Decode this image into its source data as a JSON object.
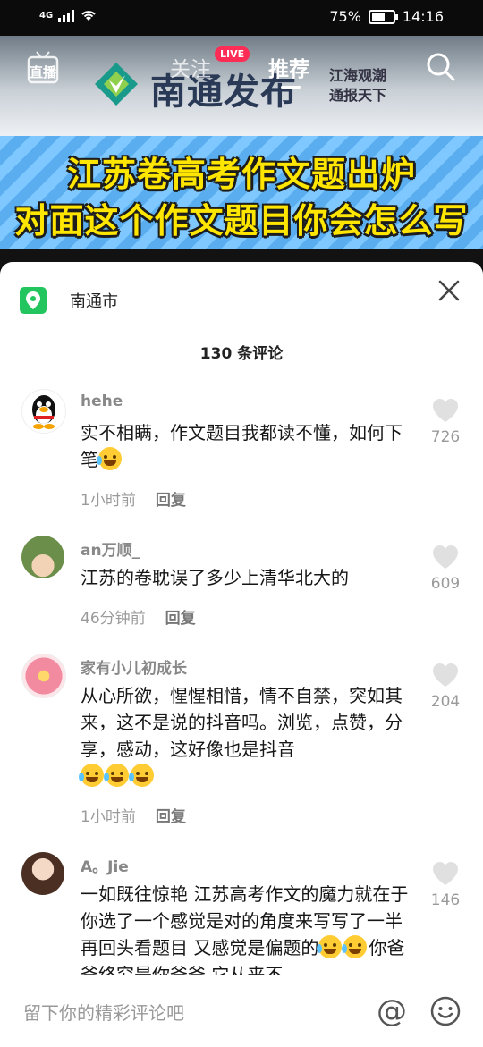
{
  "status_bar": {
    "network": "4G",
    "battery": "75%",
    "time": "14:16"
  },
  "video": {
    "brand_name": "南通发布",
    "brand_slogan_1": "江海观潮",
    "brand_slogan_2": "通报天下",
    "banner_line_1": "江苏卷高考作文题出炉",
    "banner_line_2": "对面这个作文题目你会怎么写"
  },
  "top_nav": {
    "live_label": "直播",
    "follow_tab": "关注",
    "live_badge": "LIVE",
    "recommend_tab": "推荐"
  },
  "comments_panel": {
    "location": "南通市",
    "count_label": "130 条评论",
    "reply_label": "回复",
    "comments": [
      {
        "user": "hehe",
        "text": "实不相瞒，作文题目我都读不懂，如何下笔",
        "time": "1小时前",
        "likes": "726"
      },
      {
        "user": "an万顺_",
        "text": "江苏的卷耽误了多少上清华北大的",
        "time": "46分钟前",
        "likes": "609"
      },
      {
        "user": "家有小儿初成长",
        "text": "从心所欲，惺惺相惜，情不自禁，突如其来，这不是说的抖音吗。浏览，点赞，分享，感动，这好像也是抖音",
        "time": "1小时前",
        "likes": "204"
      },
      {
        "user": "A。Jie",
        "text": "一如既往惊艳 江苏高考作文的魔力就在于 你选了一个感觉是对的角度来写写了一半再回头看题目 又感觉是偏题的",
        "text_tail": "你爸爸终究是你爸爸 它从来不",
        "likes": "146"
      }
    ]
  },
  "input_bar": {
    "placeholder": "留下你的精彩评论吧"
  }
}
